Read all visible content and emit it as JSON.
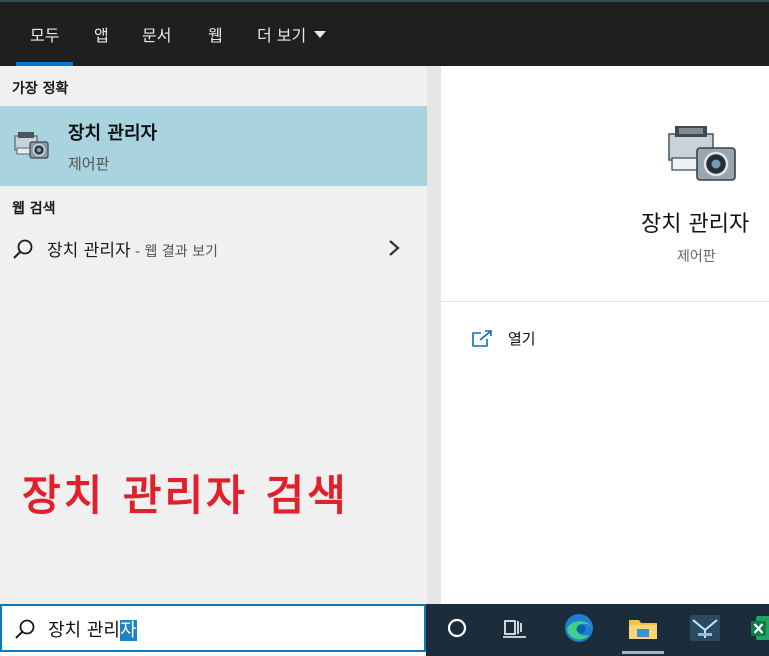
{
  "tabs": [
    {
      "label": "모두",
      "active": true
    },
    {
      "label": "앱"
    },
    {
      "label": "문서"
    },
    {
      "label": "웹"
    },
    {
      "label": "더 보기",
      "icon": "caret-down-icon"
    }
  ],
  "left": {
    "best_match_title": "가장 정확",
    "best_match": {
      "name": "장치 관리자",
      "subtitle": "제어판",
      "icon": "device-manager-icon"
    },
    "web_search_title": "웹 검색",
    "web_search": {
      "query": "장치 관리자",
      "hint": " - 웹 결과 보기",
      "icon": "search-icon",
      "chevron": "chevron-right-icon"
    },
    "overlay_caption": "장치 관리자 검색"
  },
  "preview": {
    "name": "장치 관리자",
    "subtitle": "제어판",
    "action_label": "열기",
    "action_icon": "open-external-icon"
  },
  "search_box": {
    "text_before_selection": "장치 관리",
    "selected_text": "자",
    "icon": "search-icon"
  },
  "taskbar": {
    "items": [
      "cortana-circle-icon",
      "task-view-icon",
      "edge-icon",
      "file-explorer-icon",
      "app-icon",
      "excel-icon"
    ],
    "active": "file-explorer-icon"
  },
  "colors": {
    "accent": "#0078d7",
    "highlight": "#a8d3df",
    "overlay_red": "#e0202a",
    "taskbar": "#1b2d3a"
  }
}
